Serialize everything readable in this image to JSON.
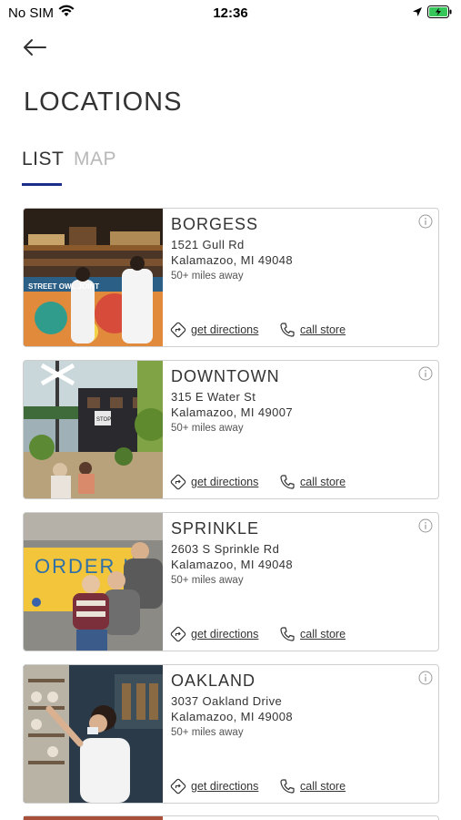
{
  "status_bar": {
    "carrier": "No SIM",
    "time": "12:36"
  },
  "page": {
    "title": "LOCATIONS"
  },
  "tabs": [
    {
      "label": "LIST",
      "active": true
    },
    {
      "label": "MAP",
      "active": false
    }
  ],
  "locations": [
    {
      "name": "BORGESS",
      "street": "1521 Gull Rd",
      "city": "Kalamazoo, MI 49048",
      "distance": "50+ miles away",
      "directions_label": "get directions",
      "call_label": "call store",
      "photo_sign_text": "STREET OWL JOINT"
    },
    {
      "name": "DOWNTOWN",
      "street": "315 E Water St",
      "city": "Kalamazoo, MI 49007",
      "distance": "50+ miles away",
      "directions_label": "get directions",
      "call_label": "call store",
      "photo_sign_text": "STOP"
    },
    {
      "name": "SPRINKLE",
      "street": "2603 S Sprinkle Rd",
      "city": "Kalamazoo, MI 49048",
      "distance": "50+ miles away",
      "directions_label": "get directions",
      "call_label": "call store",
      "photo_sign_text": "ORDER UP"
    },
    {
      "name": "OAKLAND",
      "street": "3037 Oakland Drive",
      "city": "Kalamazoo, MI 49008",
      "distance": "50+ miles away",
      "directions_label": "get directions",
      "call_label": "call store",
      "photo_sign_text": ""
    }
  ],
  "icons": {
    "back": "arrow-left-icon",
    "info": "info-icon",
    "directions": "directions-icon",
    "call": "phone-icon"
  },
  "colors": {
    "active_tab_underline": "#1b2f8a",
    "inactive_tab": "#b8b8b8",
    "text": "#333333",
    "battery": "#35c759"
  }
}
